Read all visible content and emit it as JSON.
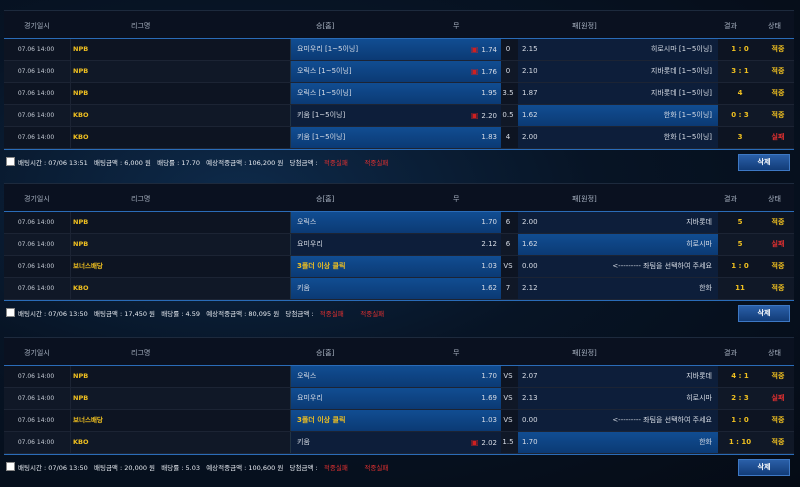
{
  "header": {
    "date": "경기일시",
    "league": "리그명",
    "home": "승[홈]",
    "draw": "무",
    "away": "패[원정]",
    "result": "결과",
    "status": "상태"
  },
  "delete_label": "삭제",
  "bets": [
    {
      "rows": [
        {
          "date": "07.06 14:00",
          "league": "NPB",
          "home": "요미우리 [1~5이닝]",
          "home_odds": "1.74",
          "draw": "0",
          "away_odds": "2.15",
          "away": "히로시마 [1~5이닝]",
          "result": "1 : 0",
          "status": "적중",
          "pick": "home",
          "mark": "home"
        },
        {
          "date": "07.06 14:00",
          "league": "NPB",
          "home": "오릭스 [1~5이닝]",
          "home_odds": "1.76",
          "draw": "0",
          "away_odds": "2.10",
          "away": "지바롯데 [1~5이닝]",
          "result": "3 : 1",
          "status": "적중",
          "pick": "home",
          "mark": "home"
        },
        {
          "date": "07.06 14:00",
          "league": "NPB",
          "home": "오릭스 [1~5이닝]",
          "home_odds": "1.95",
          "draw": "3.5",
          "away_odds": "1.87",
          "away": "지바롯데 [1~5이닝]",
          "result": "4",
          "status": "적중",
          "pick": "home",
          "mark": ""
        },
        {
          "date": "07.06 14:00",
          "league": "KBO",
          "home": "키움 [1~5이닝]",
          "home_odds": "2.20",
          "draw": "0.5",
          "away_odds": "1.62",
          "away": "한화 [1~5이닝]",
          "result": "0 : 3",
          "status": "적중",
          "pick": "away",
          "mark": "home"
        },
        {
          "date": "07.06 14:00",
          "league": "KBO",
          "home": "키움 [1~5이닝]",
          "home_odds": "1.83",
          "draw": "4",
          "away_odds": "2.00",
          "away": "한화 [1~5이닝]",
          "result": "3",
          "status": "실패",
          "pick": "home",
          "mark": ""
        }
      ],
      "footer": {
        "time": "배팅시간 : 07/06 13:51",
        "amount": "배팅금액 : 6,000 원",
        "odds": "배당률 : 17.70",
        "expected": "예상적중금액 : 106,200 원",
        "win_label": "당첨금액 :",
        "win_val": "적중실패",
        "state": "적중실패"
      }
    },
    {
      "rows": [
        {
          "date": "07.06 14:00",
          "league": "NPB",
          "home": "오릭스",
          "home_odds": "1.70",
          "draw": "6",
          "away_odds": "2.00",
          "away": "지바롯데",
          "result": "5",
          "status": "적중",
          "pick": "home",
          "mark": ""
        },
        {
          "date": "07.06 14:00",
          "league": "NPB",
          "home": "요미우리",
          "home_odds": "2.12",
          "draw": "6",
          "away_odds": "1.62",
          "away": "히로시마",
          "result": "5",
          "status": "실패",
          "pick": "away",
          "mark": ""
        },
        {
          "date": "07.06 14:00",
          "league": "보너스배당",
          "home": "3폴더 이상 클릭",
          "home_odds": "1.03",
          "draw": "VS",
          "away_odds": "0.00",
          "away": "<--------- 좌팀을 선택하여 주세요",
          "result": "1 : 0",
          "status": "적중",
          "pick": "home",
          "mark": "",
          "yellow": true
        },
        {
          "date": "07.06 14:00",
          "league": "KBO",
          "home": "키움",
          "home_odds": "1.62",
          "draw": "7",
          "away_odds": "2.12",
          "away": "한화",
          "result": "11",
          "status": "적중",
          "pick": "home",
          "mark": ""
        }
      ],
      "footer": {
        "time": "배팅시간 : 07/06 13:50",
        "amount": "배팅금액 : 17,450 원",
        "odds": "배당률 : 4.59",
        "expected": "예상적중금액 : 80,095 원",
        "win_label": "당첨금액 :",
        "win_val": "적중실패",
        "state": "적중실패"
      }
    },
    {
      "rows": [
        {
          "date": "07.06 14:00",
          "league": "NPB",
          "home": "오릭스",
          "home_odds": "1.70",
          "draw": "VS",
          "away_odds": "2.07",
          "away": "지바롯데",
          "result": "4 : 1",
          "status": "적중",
          "pick": "home",
          "mark": ""
        },
        {
          "date": "07.06 14:00",
          "league": "NPB",
          "home": "요미우리",
          "home_odds": "1.69",
          "draw": "VS",
          "away_odds": "2.13",
          "away": "히로시마",
          "result": "2 : 3",
          "status": "실패",
          "pick": "home",
          "mark": ""
        },
        {
          "date": "07.06 14:00",
          "league": "보너스배당",
          "home": "3폴더 이상 클릭",
          "home_odds": "1.03",
          "draw": "VS",
          "away_odds": "0.00",
          "away": "<--------- 좌팀을 선택하여 주세요",
          "result": "1 : 0",
          "status": "적중",
          "pick": "home",
          "mark": "",
          "yellow": true
        },
        {
          "date": "07.06 14:00",
          "league": "KBO",
          "home": "키움",
          "home_odds": "2.02",
          "draw": "1.5",
          "away_odds": "1.70",
          "away": "한화",
          "result": "1 : 10",
          "status": "적중",
          "pick": "away",
          "mark": "home"
        }
      ],
      "footer": {
        "time": "배팅시간 : 07/06 13:50",
        "amount": "배팅금액 : 20,000 원",
        "odds": "배당률 : 5.03",
        "expected": "예상적중금액 : 100,600 원",
        "win_label": "당첨금액 :",
        "win_val": "적중실패",
        "state": "적중실패"
      }
    }
  ]
}
